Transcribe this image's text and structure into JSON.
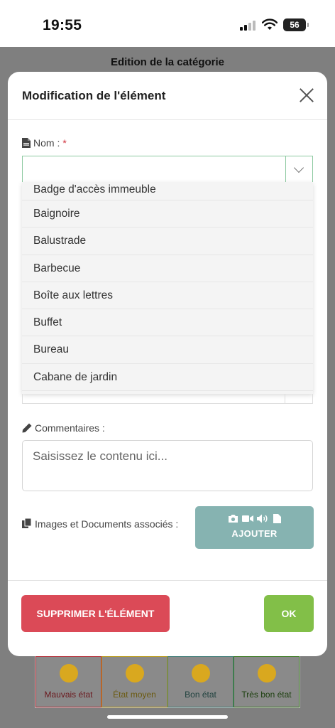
{
  "status_bar": {
    "time": "19:55",
    "battery": "56"
  },
  "background": {
    "page_title": "Edition de la catégorie",
    "states": [
      {
        "label": "Mauvais état",
        "color": "#b4303a"
      },
      {
        "label": "État moyen",
        "color": "#b99a1a"
      },
      {
        "label": "Bon état",
        "color": "#3f7d77"
      },
      {
        "label": "Très bon état",
        "color": "#3d7a24"
      }
    ]
  },
  "modal": {
    "title": "Modification de l'élément",
    "name_field": {
      "label": "Nom :",
      "required_mark": "*",
      "value": "",
      "options": [
        "Badge d'accès immeuble",
        "Baignoire",
        "Balustrade",
        "Barbecue",
        "Boîte aux lettres",
        "Buffet",
        "Bureau",
        "Cabane de jardin"
      ]
    },
    "comments": {
      "label": "Commentaires :",
      "placeholder": "Saisissez le contenu ici..."
    },
    "attachments": {
      "label": "Images et Documents associés :",
      "add_button": "AJOUTER"
    },
    "delete_button": "SUPPRIMER L'ÉLÉMENT",
    "ok_button": "OK",
    "colors": {
      "delete": "#db4a57",
      "ok": "#82bf48",
      "add": "#86b3b1",
      "focus": "#8cc9a0"
    }
  }
}
